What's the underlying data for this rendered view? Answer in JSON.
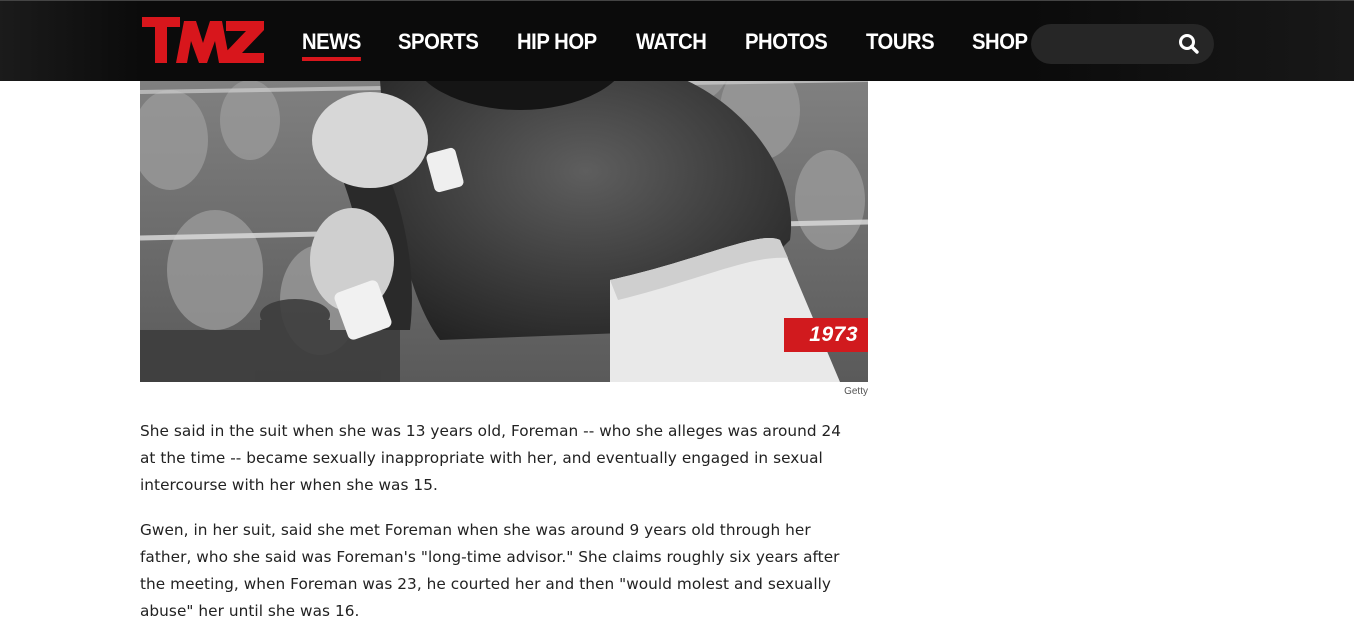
{
  "site": {
    "logo_text": "TMZ",
    "brand_color": "#d8161c"
  },
  "nav": {
    "items": [
      {
        "label": "NEWS",
        "active": true
      },
      {
        "label": "SPORTS",
        "active": false
      },
      {
        "label": "HIP HOP",
        "active": false
      },
      {
        "label": "WATCH",
        "active": false
      },
      {
        "label": "PHOTOS",
        "active": false
      },
      {
        "label": "TOURS",
        "active": false
      },
      {
        "label": "SHOP",
        "active": false
      }
    ]
  },
  "search": {
    "placeholder": "",
    "icon": "search-icon"
  },
  "article": {
    "image": {
      "year_badge": "1973",
      "credit": "Getty"
    },
    "paragraphs": [
      "She said in the suit when she was 13 years old, Foreman -- who she alleges was around 24 at the time -- became sexually inappropriate with her, and eventually engaged in sexual intercourse with her when she was 15.",
      "Gwen, in her suit, said she met Foreman when she was around 9 years old through her father, who she said was Foreman's \"long-time advisor.\" She claims roughly six years after the meeting, when Foreman was 23, he courted her and then \"would molest and sexually abuse\" her until she was 16."
    ]
  }
}
